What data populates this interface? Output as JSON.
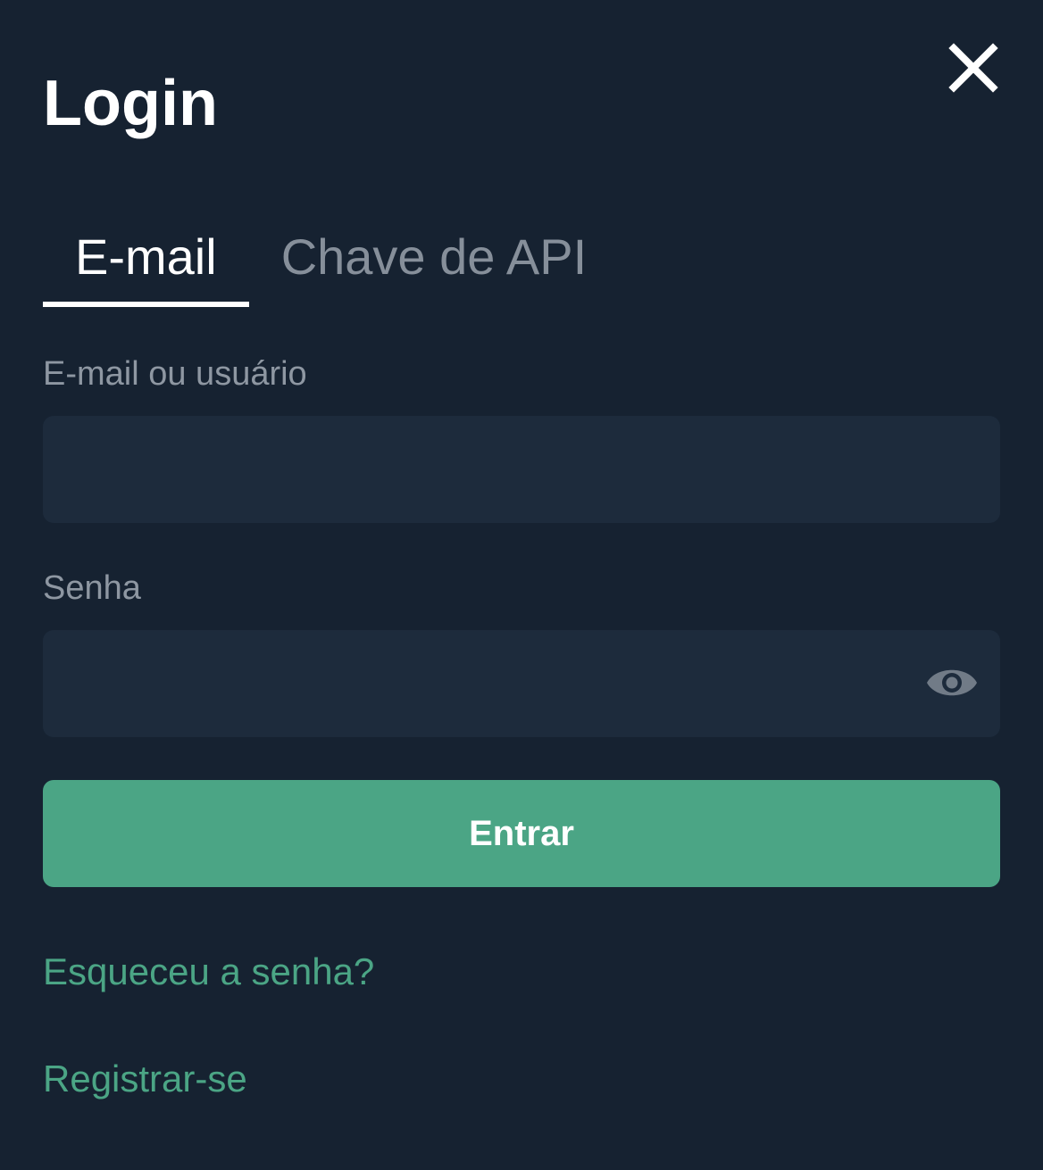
{
  "dialog": {
    "title": "Login"
  },
  "tabs": [
    {
      "label": "E-mail",
      "active": true
    },
    {
      "label": "Chave de API",
      "active": false
    }
  ],
  "form": {
    "email_label": "E-mail ou usuário",
    "email_value": "",
    "email_placeholder": "",
    "password_label": "Senha",
    "password_value": "",
    "password_placeholder": "",
    "submit_label": "Entrar"
  },
  "links": {
    "forgot_password": "Esqueceu a senha?",
    "register": "Registrar-se"
  },
  "icons": {
    "close": "close-icon",
    "toggle_password": "eye-icon"
  },
  "colors": {
    "background": "#162231",
    "input_background": "#1d2b3c",
    "accent": "#4ba585",
    "text_primary": "#ffffff",
    "text_muted": "#868f9a"
  }
}
